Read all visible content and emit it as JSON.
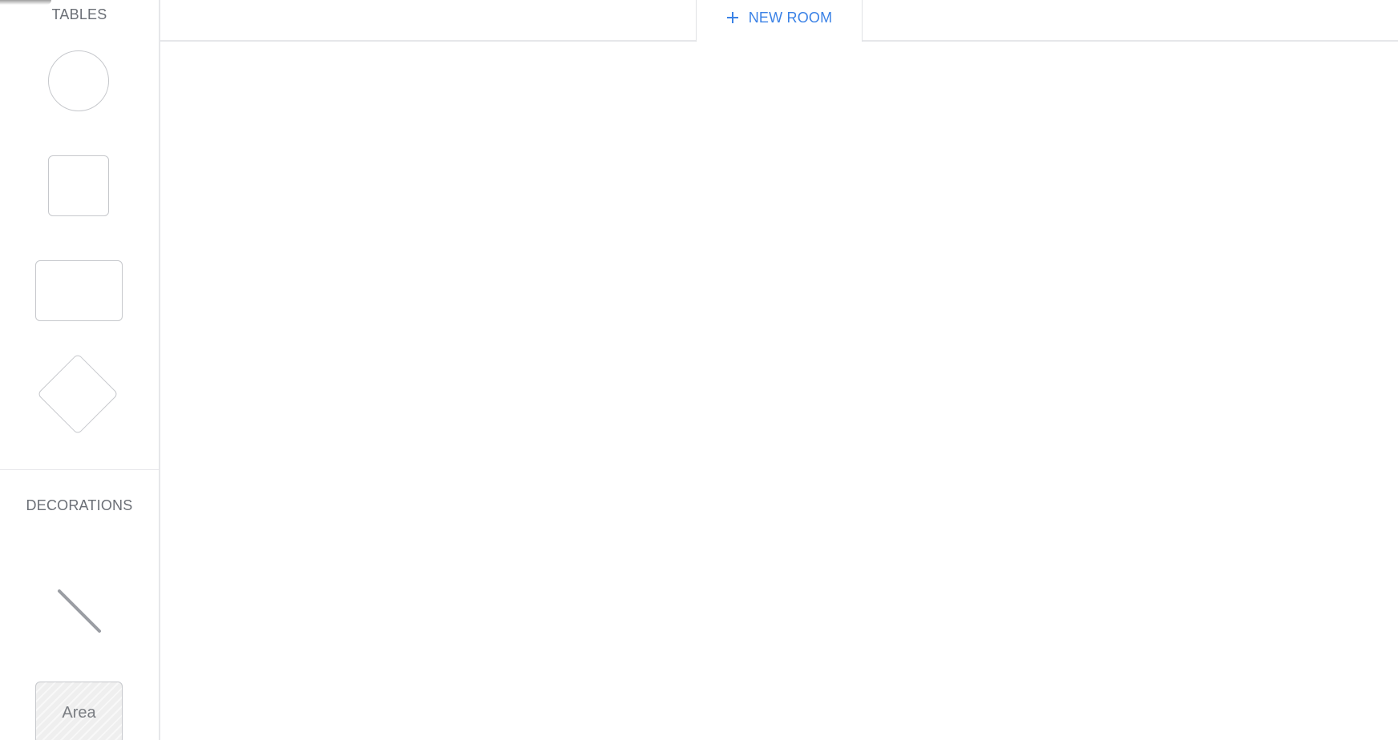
{
  "sidebar": {
    "tables_title": "TABLES",
    "table_shapes": [
      "round-table",
      "square-table",
      "rectangle-table",
      "diamond-table"
    ],
    "decorations_title": "DECORATIONS",
    "decorations": {
      "line_icon": "diagonal-line-icon",
      "area_label": "Area"
    }
  },
  "topbar": {
    "new_room_icon": "plus-icon",
    "new_room_label": "NEW ROOM"
  },
  "colors": {
    "accent": "#3b82e6",
    "shape_border": "#c6c8cc",
    "section_title": "#6b6f76",
    "divider": "#e6e7ea"
  }
}
